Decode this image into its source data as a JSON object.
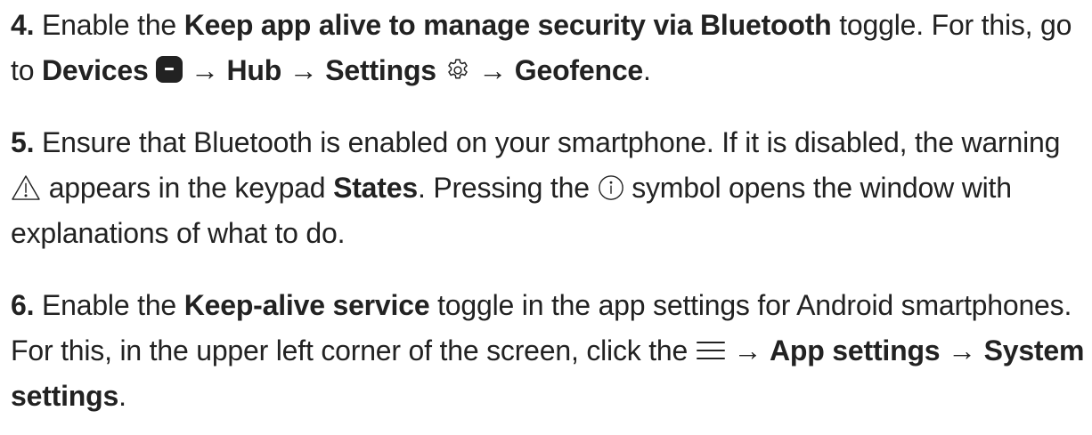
{
  "steps": [
    {
      "number": "4.",
      "parts": {
        "t1": "Enable the ",
        "b1": "Keep app alive to manage security via Bluetooth",
        "t2": " toggle. For this, go to ",
        "b2": "Devices",
        "t3": " → ",
        "b3": "Hub",
        "t4": " → ",
        "b4": "Settings",
        "t5": " → ",
        "b5": "Geofence",
        "t6": "."
      }
    },
    {
      "number": "5.",
      "parts": {
        "t1": "Ensure that Bluetooth is enabled on your smartphone. If it is disabled, the warning ",
        "t2": " appears in the keypad ",
        "b1": "States",
        "t3": ". Pressing the ",
        "t4": " symbol opens the window with explanations of what to do."
      }
    },
    {
      "number": "6.",
      "parts": {
        "t1": "Enable the ",
        "b1": "Keep-alive service",
        "t2": " toggle in the app settings for Android smartphones. For this, in the upper left corner of the screen, click the ",
        "t3": " → ",
        "b2": "App settings",
        "t4": " → ",
        "b3": "System settings",
        "t5": "."
      }
    }
  ],
  "icons": {
    "devices": "hub-device-icon",
    "settings": "gear-icon",
    "warning": "warning-triangle-icon",
    "info": "info-circle-icon",
    "menu": "hamburger-menu-icon"
  },
  "colors": {
    "text": "#222222",
    "background": "#ffffff"
  }
}
